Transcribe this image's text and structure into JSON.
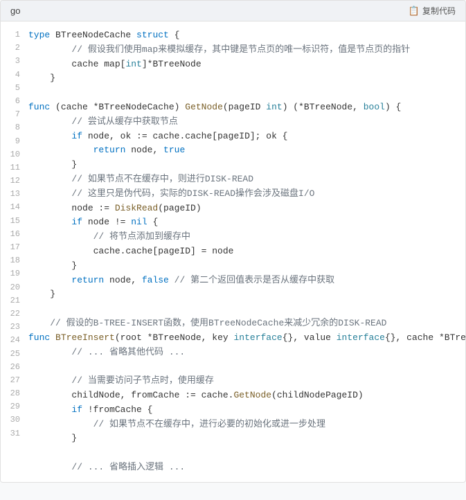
{
  "header": {
    "lang": "go",
    "copy_label": "复制代码"
  },
  "lines": [
    {
      "num": 1,
      "tokens": [
        {
          "t": "kw",
          "v": "type"
        },
        {
          "t": "plain",
          "v": " BTreeNodeCache "
        },
        {
          "t": "kw",
          "v": "struct"
        },
        {
          "t": "plain",
          "v": " {"
        }
      ]
    },
    {
      "num": 2,
      "tokens": [
        {
          "t": "comment",
          "v": "        // 假设我们使用map来模拟缓存，其中键是节点页的唯一标识符，值是节点页的指针"
        }
      ]
    },
    {
      "num": 3,
      "tokens": [
        {
          "t": "plain",
          "v": "        cache map["
        },
        {
          "t": "kw-green",
          "v": "int"
        },
        {
          "t": "plain",
          "v": "]*BTreeNode"
        }
      ]
    },
    {
      "num": 4,
      "tokens": [
        {
          "t": "plain",
          "v": "    }"
        }
      ]
    },
    {
      "num": 5,
      "tokens": [
        {
          "t": "plain",
          "v": ""
        }
      ]
    },
    {
      "num": 6,
      "tokens": [
        {
          "t": "kw",
          "v": "func"
        },
        {
          "t": "plain",
          "v": " (cache *BTreeNodeCache) "
        },
        {
          "t": "fn",
          "v": "GetNode"
        },
        {
          "t": "plain",
          "v": "(pageID "
        },
        {
          "t": "kw-green",
          "v": "int"
        },
        {
          "t": "plain",
          "v": ") (*BTreeNode, "
        },
        {
          "t": "kw-green",
          "v": "bool"
        },
        {
          "t": "plain",
          "v": ") {"
        }
      ]
    },
    {
      "num": 7,
      "tokens": [
        {
          "t": "comment",
          "v": "        // 尝试从缓存中获取节点"
        }
      ]
    },
    {
      "num": 8,
      "tokens": [
        {
          "t": "plain",
          "v": "        "
        },
        {
          "t": "kw",
          "v": "if"
        },
        {
          "t": "plain",
          "v": " node, ok := cache.cache[pageID]; ok {"
        }
      ]
    },
    {
      "num": 9,
      "tokens": [
        {
          "t": "plain",
          "v": "            "
        },
        {
          "t": "kw",
          "v": "return"
        },
        {
          "t": "plain",
          "v": " node, "
        },
        {
          "t": "bool-val",
          "v": "true"
        }
      ]
    },
    {
      "num": 10,
      "tokens": [
        {
          "t": "plain",
          "v": "        }"
        }
      ]
    },
    {
      "num": 11,
      "tokens": [
        {
          "t": "comment",
          "v": "        // 如果节点不在缓存中，则进行DISK-READ"
        }
      ]
    },
    {
      "num": 12,
      "tokens": [
        {
          "t": "comment",
          "v": "        // 这里只是伪代码，实际的DISK-READ操作会涉及磁盘I/O"
        }
      ]
    },
    {
      "num": 13,
      "tokens": [
        {
          "t": "plain",
          "v": "        node := "
        },
        {
          "t": "fn",
          "v": "DiskRead"
        },
        {
          "t": "plain",
          "v": "(pageID)"
        }
      ]
    },
    {
      "num": 14,
      "tokens": [
        {
          "t": "plain",
          "v": "        "
        },
        {
          "t": "kw",
          "v": "if"
        },
        {
          "t": "plain",
          "v": " node != "
        },
        {
          "t": "kw",
          "v": "nil"
        },
        {
          "t": "plain",
          "v": " {"
        }
      ]
    },
    {
      "num": 15,
      "tokens": [
        {
          "t": "comment",
          "v": "            // 将节点添加到缓存中"
        }
      ]
    },
    {
      "num": 16,
      "tokens": [
        {
          "t": "plain",
          "v": "            cache.cache[pageID] = node"
        }
      ]
    },
    {
      "num": 17,
      "tokens": [
        {
          "t": "plain",
          "v": "        }"
        }
      ]
    },
    {
      "num": 18,
      "tokens": [
        {
          "t": "plain",
          "v": "        "
        },
        {
          "t": "kw",
          "v": "return"
        },
        {
          "t": "plain",
          "v": " node, "
        },
        {
          "t": "bool-val",
          "v": "false"
        },
        {
          "t": "comment",
          "v": " // 第二个返回值表示是否从缓存中获取"
        }
      ]
    },
    {
      "num": 19,
      "tokens": [
        {
          "t": "plain",
          "v": "    }"
        }
      ]
    },
    {
      "num": 20,
      "tokens": [
        {
          "t": "plain",
          "v": ""
        }
      ]
    },
    {
      "num": 21,
      "tokens": [
        {
          "t": "comment",
          "v": "    // 假设的B-TREE-INSERT函数，使用BTreeNodeCache来减少冗余的DISK-READ"
        }
      ]
    },
    {
      "num": 22,
      "tokens": [
        {
          "t": "kw",
          "v": "func"
        },
        {
          "t": "plain",
          "v": " "
        },
        {
          "t": "fn",
          "v": "BTreeInsert"
        },
        {
          "t": "plain",
          "v": "(root *BTreeNode, key "
        },
        {
          "t": "kw-green",
          "v": "interface"
        },
        {
          "t": "plain",
          "v": "{}, value "
        },
        {
          "t": "kw-green",
          "v": "interface"
        },
        {
          "t": "plain",
          "v": "{}, cache *BTreeNod"
        }
      ]
    },
    {
      "num": 23,
      "tokens": [
        {
          "t": "comment",
          "v": "        // ... 省略其他代码 ..."
        }
      ]
    },
    {
      "num": 24,
      "tokens": [
        {
          "t": "plain",
          "v": ""
        }
      ]
    },
    {
      "num": 25,
      "tokens": [
        {
          "t": "comment",
          "v": "        // 当需要访问子节点时，使用缓存"
        }
      ]
    },
    {
      "num": 26,
      "tokens": [
        {
          "t": "plain",
          "v": "        childNode, fromCache := cache."
        },
        {
          "t": "fn",
          "v": "GetNode"
        },
        {
          "t": "plain",
          "v": "(childNodePageID)"
        }
      ]
    },
    {
      "num": 27,
      "tokens": [
        {
          "t": "plain",
          "v": "        "
        },
        {
          "t": "kw",
          "v": "if"
        },
        {
          "t": "plain",
          "v": " !fromCache {"
        }
      ]
    },
    {
      "num": 28,
      "tokens": [
        {
          "t": "comment",
          "v": "            // 如果节点不在缓存中，进行必要的初始化或进一步处理"
        }
      ]
    },
    {
      "num": 29,
      "tokens": [
        {
          "t": "plain",
          "v": "        }"
        }
      ]
    },
    {
      "num": 30,
      "tokens": [
        {
          "t": "plain",
          "v": ""
        }
      ]
    },
    {
      "num": 31,
      "tokens": [
        {
          "t": "comment",
          "v": "        // ... 省略插入逻辑 ..."
        }
      ]
    }
  ]
}
